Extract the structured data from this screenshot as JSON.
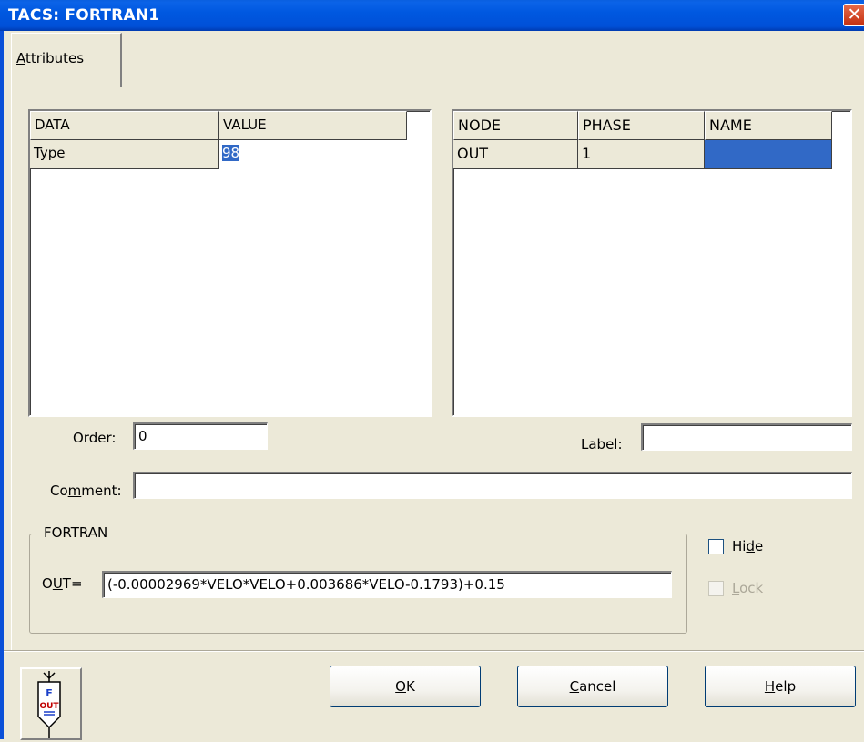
{
  "window": {
    "title": "TACS: FORTRAN1",
    "close_glyph": "✕"
  },
  "tab": {
    "label_first": "A",
    "label_rest": "ttributes"
  },
  "data_table": {
    "headers": [
      "DATA",
      "VALUE"
    ],
    "rows": [
      {
        "data": "Type",
        "value": "98"
      }
    ]
  },
  "node_table": {
    "headers": [
      "NODE",
      "PHASE",
      "NAME"
    ],
    "rows": [
      {
        "node": "OUT",
        "phase": "1",
        "name": ""
      }
    ]
  },
  "order": {
    "label": "Order:",
    "value": "0"
  },
  "label_field": {
    "label": "Label:",
    "value": ""
  },
  "comment": {
    "label_pre": "Co",
    "label_key": "m",
    "label_post": "ment:",
    "value": ""
  },
  "fortran": {
    "group_title": "FORTRAN",
    "out_label_pre": "O",
    "out_label_key": "U",
    "out_label_post": "T=",
    "expression": "(-0.00002969*VELO*VELO+0.003686*VELO-0.1793)+0.15"
  },
  "hide": {
    "label_pre": "Hi",
    "label_key": "d",
    "label_post": "e",
    "checked": false
  },
  "lock": {
    "label_key": "L",
    "label_post": "ock",
    "checked": false,
    "enabled": false
  },
  "buttons": {
    "ok": {
      "key": "O",
      "rest": "K"
    },
    "cancel": {
      "key": "C",
      "rest": "ancel"
    },
    "help": {
      "key": "H",
      "rest": "elp"
    }
  },
  "component_icon": {
    "name": "fortran-component-icon",
    "top_text": "F",
    "mid_text": "OUT"
  },
  "colors": {
    "titlebar": "#0058e0",
    "dialog_bg": "#ece9d8",
    "selection": "#3169c6",
    "close_button": "#c43010"
  }
}
